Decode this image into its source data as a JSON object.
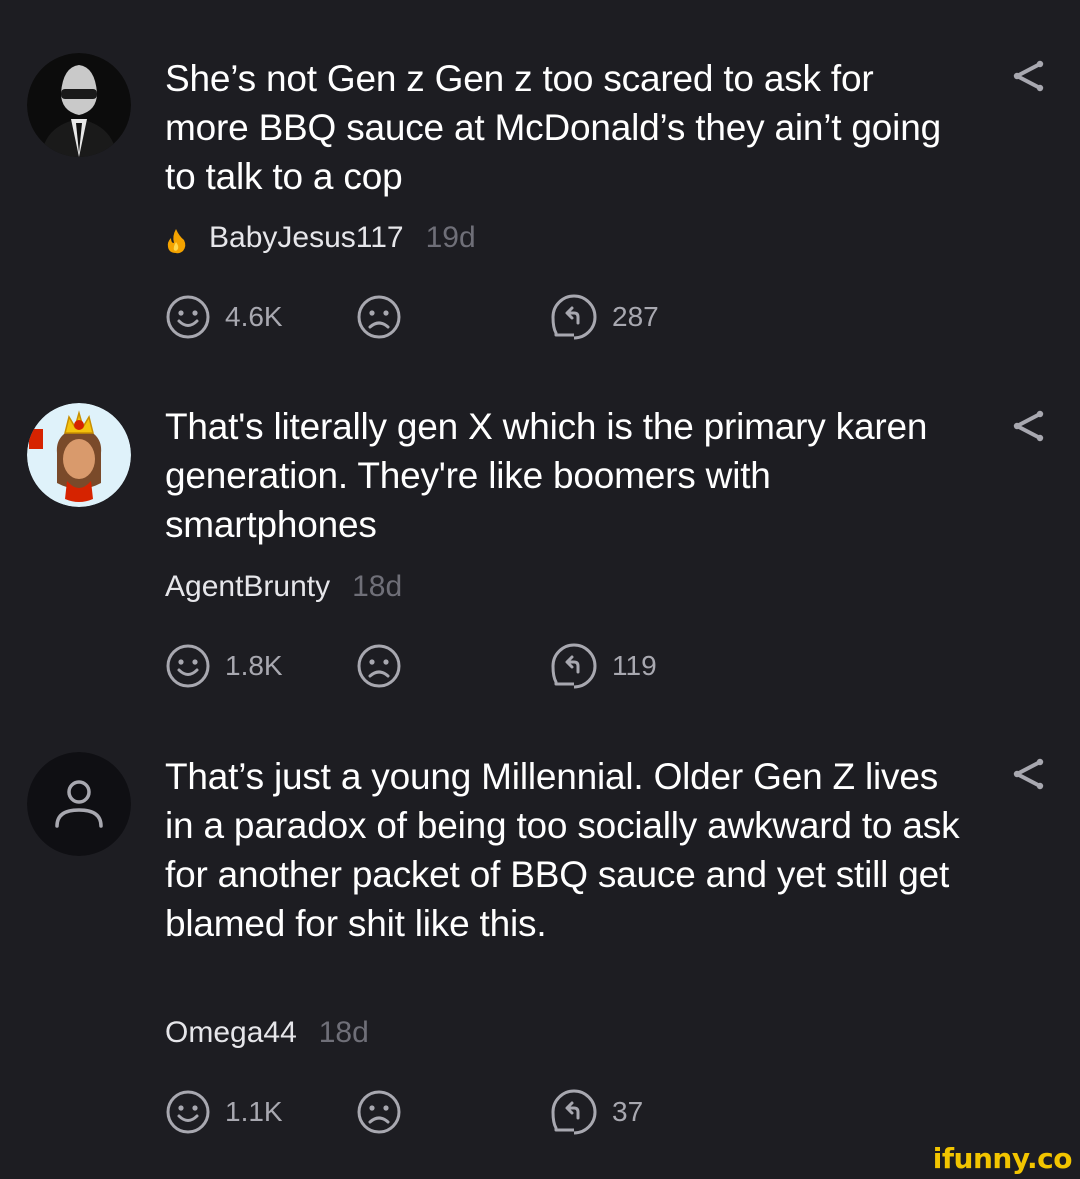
{
  "colors": {
    "background": "#1d1d22",
    "text": "#ffffff",
    "muted": "#6f6f78",
    "icon": "#a8a8b0",
    "watermark": "#f2c500"
  },
  "comments": [
    {
      "avatar": "suited-man-avatar",
      "text": "She’s not Gen z Gen z too scared to ask for more BBQ sauce at McDonald’s they ain’t going to talk to a cop",
      "badge_icon": "fire-icon",
      "user": "BabyJesus117",
      "age": "19d",
      "smiles": "4.6K",
      "replies": "287"
    },
    {
      "avatar": "burger-king-avatar",
      "text": "That's literally gen X which is the primary karen generation. They're like boomers with smartphones",
      "user": "AgentBrunty",
      "age": "18d",
      "smiles": "1.8K",
      "replies": "119"
    },
    {
      "avatar": "default-user-avatar",
      "text": "That’s just a young Millennial. Older Gen Z lives in a paradox of being too socially awkward to ask for another packet of BBQ sauce and yet still get blamed for shit like this.",
      "user": "Omega44",
      "age": "18d",
      "smiles": "1.1K",
      "replies": "37"
    }
  ],
  "watermark": "ifunny.co"
}
